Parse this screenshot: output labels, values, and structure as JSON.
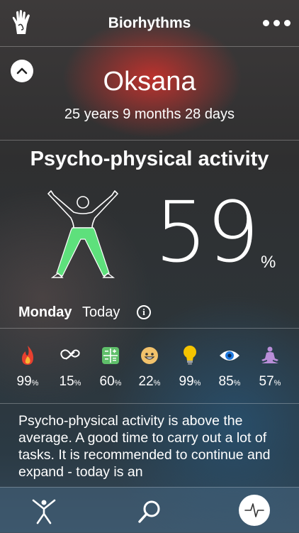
{
  "header": {
    "title": "Biorhythms",
    "left_icon": "hand-icon",
    "right_icon": "more-icon"
  },
  "profile": {
    "name": "Oksana",
    "age": "25 years 9 months 28 days"
  },
  "activity": {
    "title": "Psycho-physical activity",
    "value": "59",
    "unit": "%",
    "day": "Monday",
    "today": "Today"
  },
  "metrics": [
    {
      "icon": "fire-icon",
      "value": "99",
      "unit": "%"
    },
    {
      "icon": "infinity-icon",
      "value": "15",
      "unit": "%"
    },
    {
      "icon": "calculator-icon",
      "value": "60",
      "unit": "%"
    },
    {
      "icon": "smiley-icon",
      "value": "22",
      "unit": "%"
    },
    {
      "icon": "lightbulb-icon",
      "value": "99",
      "unit": "%"
    },
    {
      "icon": "eye-icon",
      "value": "85",
      "unit": "%"
    },
    {
      "icon": "meditation-icon",
      "value": "57",
      "unit": "%"
    }
  ],
  "description": "Psycho-physical activity is above the average. A good time to carry out a lot of tasks. It is recommended to continue and expand - today is an",
  "tabs": [
    {
      "icon": "person-icon"
    },
    {
      "icon": "search-icon"
    },
    {
      "icon": "pulse-icon",
      "active": true
    }
  ],
  "colors": {
    "accent_green": "#5ee07c",
    "fire": "#e8402f",
    "bulb": "#f5c400",
    "eye": "#1f7ae0",
    "meditation": "#b98ed8"
  }
}
